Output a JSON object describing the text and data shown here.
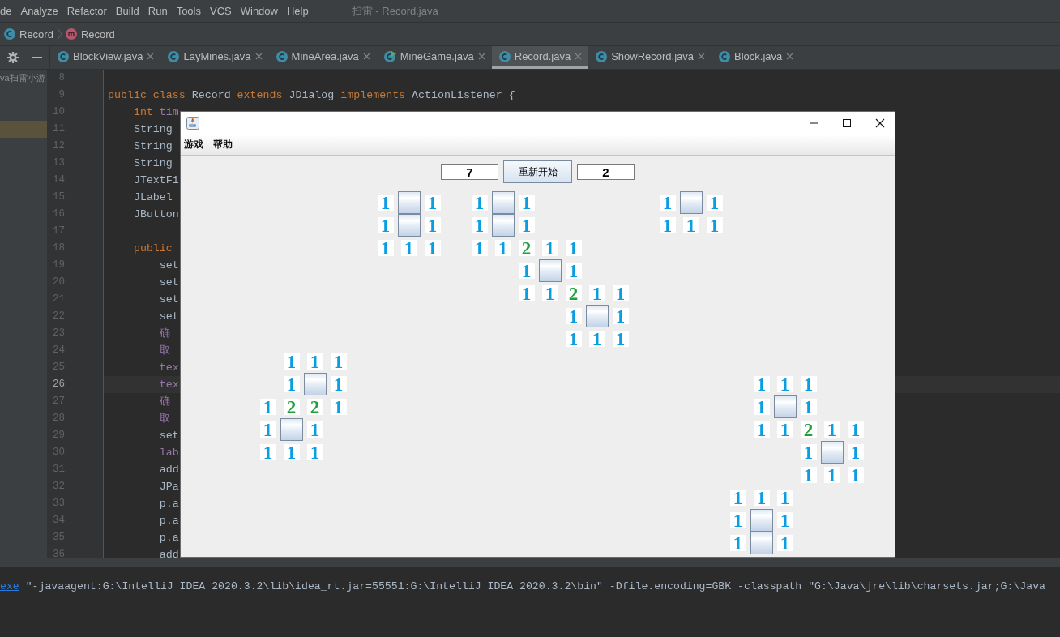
{
  "menu_bar": {
    "items": [
      "de",
      "Analyze",
      "Refactor",
      "Build",
      "Run",
      "Tools",
      "VCS",
      "Window",
      "Help"
    ],
    "title": "扫雷 - Record.java"
  },
  "breadcrumb": [
    {
      "kind": "class",
      "label": "Record"
    },
    {
      "kind": "method",
      "label": "Record"
    }
  ],
  "tabs": [
    {
      "label": "BlockView.java",
      "kind": "class",
      "selected": false
    },
    {
      "label": "LayMines.java",
      "kind": "class",
      "selected": false
    },
    {
      "label": "MineArea.java",
      "kind": "class",
      "selected": false
    },
    {
      "label": "MineGame.java",
      "kind": "runnable",
      "selected": false
    },
    {
      "label": "Record.java",
      "kind": "class",
      "selected": true
    },
    {
      "label": "ShowRecord.java",
      "kind": "class",
      "selected": false
    },
    {
      "label": "Block.java",
      "kind": "class",
      "selected": false
    }
  ],
  "project_panel": {
    "rows": [
      {
        "text": "va扫雷小游",
        "selected": false
      },
      {
        "selected": false
      },
      {
        "selected": false
      },
      {
        "selected": true
      }
    ]
  },
  "editor": {
    "lines": [
      {
        "number": "8",
        "current": false
      },
      {
        "number": "9",
        "current": false,
        "tokens": [
          {
            "kind": "keyword",
            "text": "public class"
          },
          {
            "kind": "plain",
            "text": " Record "
          },
          {
            "kind": "keyword",
            "text": "extends"
          },
          {
            "kind": "plain",
            "text": " JDialog "
          },
          {
            "kind": "keyword",
            "text": "implements"
          },
          {
            "kind": "plain",
            "text": " ActionListener {"
          }
        ]
      },
      {
        "number": "10",
        "current": false,
        "tokens": [
          {
            "kind": "keyword",
            "text": "    int"
          },
          {
            "kind": "field",
            "text": " tim"
          }
        ]
      },
      {
        "number": "11",
        "current": false,
        "tokens": [
          {
            "kind": "plain",
            "text": "    String"
          }
        ]
      },
      {
        "number": "12",
        "current": false,
        "tokens": [
          {
            "kind": "plain",
            "text": "    String"
          }
        ]
      },
      {
        "number": "13",
        "current": false,
        "tokens": [
          {
            "kind": "plain",
            "text": "    String"
          }
        ]
      },
      {
        "number": "14",
        "current": false,
        "tokens": [
          {
            "kind": "plain",
            "text": "    JTextFi"
          }
        ]
      },
      {
        "number": "15",
        "current": false,
        "tokens": [
          {
            "kind": "plain",
            "text": "    JLabel"
          }
        ]
      },
      {
        "number": "16",
        "current": false,
        "tokens": [
          {
            "kind": "plain",
            "text": "    JButton"
          }
        ]
      },
      {
        "number": "17",
        "current": false
      },
      {
        "number": "18",
        "current": false,
        "tokens": [
          {
            "kind": "keyword",
            "text": "    public"
          }
        ]
      },
      {
        "number": "19",
        "current": false,
        "tokens": [
          {
            "kind": "plain",
            "text": "        set"
          }
        ]
      },
      {
        "number": "20",
        "current": false,
        "tokens": [
          {
            "kind": "plain",
            "text": "        set"
          }
        ]
      },
      {
        "number": "21",
        "current": false,
        "tokens": [
          {
            "kind": "plain",
            "text": "        set"
          }
        ]
      },
      {
        "number": "22",
        "current": false,
        "tokens": [
          {
            "kind": "plain",
            "text": "        set"
          }
        ]
      },
      {
        "number": "23",
        "current": false,
        "tokens": [
          {
            "kind": "field",
            "text": "        确"
          }
        ]
      },
      {
        "number": "24",
        "current": false,
        "tokens": [
          {
            "kind": "field",
            "text": "        取"
          }
        ]
      },
      {
        "number": "25",
        "current": false,
        "tokens": [
          {
            "kind": "field",
            "text": "        tex"
          }
        ]
      },
      {
        "number": "26",
        "current": true,
        "tokens": [
          {
            "kind": "field",
            "text": "        tex"
          }
        ]
      },
      {
        "number": "27",
        "current": false,
        "tokens": [
          {
            "kind": "field",
            "text": "        确"
          }
        ]
      },
      {
        "number": "28",
        "current": false,
        "tokens": [
          {
            "kind": "field",
            "text": "        取"
          }
        ]
      },
      {
        "number": "29",
        "current": false,
        "tokens": [
          {
            "kind": "plain",
            "text": "        set"
          }
        ]
      },
      {
        "number": "30",
        "current": false,
        "tokens": [
          {
            "kind": "field",
            "text": "        lab"
          }
        ]
      },
      {
        "number": "31",
        "current": false,
        "tokens": [
          {
            "kind": "plain",
            "text": "        add"
          }
        ]
      },
      {
        "number": "32",
        "current": false,
        "tokens": [
          {
            "kind": "plain",
            "text": "        JPa"
          }
        ]
      },
      {
        "number": "33",
        "current": false,
        "tokens": [
          {
            "kind": "plain",
            "text": "        p.a"
          }
        ]
      },
      {
        "number": "34",
        "current": false,
        "tokens": [
          {
            "kind": "plain",
            "text": "        p.a"
          }
        ]
      },
      {
        "number": "35",
        "current": false,
        "tokens": [
          {
            "kind": "plain",
            "text": "        p.a"
          }
        ]
      },
      {
        "number": "36",
        "current": false,
        "tokens": [
          {
            "kind": "plain",
            "text": "        add"
          }
        ]
      }
    ]
  },
  "dialog": {
    "menu": [
      "游戏",
      "帮助"
    ],
    "left_counter": "7",
    "button": "重新开始",
    "right_counter": "2",
    "board": [
      {
        "cells": [
          {
            "kind": "blank"
          },
          {
            "kind": "blank"
          },
          {
            "kind": "blank"
          },
          {
            "kind": "blank"
          },
          {
            "kind": "blank"
          },
          {
            "kind": "blank"
          },
          {
            "kind": "blank"
          },
          {
            "kind": "blank"
          },
          {
            "kind": "number",
            "text": "1",
            "color": "#0a9ee0"
          },
          {
            "kind": "hidden"
          },
          {
            "kind": "number",
            "text": "1",
            "color": "#0a9ee0"
          },
          {
            "kind": "blank"
          },
          {
            "kind": "number",
            "text": "1",
            "color": "#0a9ee0"
          },
          {
            "kind": "hidden"
          },
          {
            "kind": "number",
            "text": "1",
            "color": "#0a9ee0"
          },
          {
            "kind": "blank"
          },
          {
            "kind": "blank"
          },
          {
            "kind": "blank"
          },
          {
            "kind": "blank"
          },
          {
            "kind": "blank"
          },
          {
            "kind": "number",
            "text": "1",
            "color": "#0a9ee0"
          },
          {
            "kind": "hidden"
          },
          {
            "kind": "number",
            "text": "1",
            "color": "#0a9ee0"
          },
          {
            "kind": "blank"
          },
          {
            "kind": "blank"
          },
          {
            "kind": "blank"
          },
          {
            "kind": "blank"
          },
          {
            "kind": "blank"
          },
          {
            "kind": "blank"
          },
          {
            "kind": "blank"
          }
        ]
      },
      {
        "cells": [
          {
            "kind": "blank"
          },
          {
            "kind": "blank"
          },
          {
            "kind": "blank"
          },
          {
            "kind": "blank"
          },
          {
            "kind": "blank"
          },
          {
            "kind": "blank"
          },
          {
            "kind": "blank"
          },
          {
            "kind": "blank"
          },
          {
            "kind": "number",
            "text": "1",
            "color": "#0a9ee0"
          },
          {
            "kind": "hidden"
          },
          {
            "kind": "number",
            "text": "1",
            "color": "#0a9ee0"
          },
          {
            "kind": "blank"
          },
          {
            "kind": "number",
            "text": "1",
            "color": "#0a9ee0"
          },
          {
            "kind": "hidden"
          },
          {
            "kind": "number",
            "text": "1",
            "color": "#0a9ee0"
          },
          {
            "kind": "blank"
          },
          {
            "kind": "blank"
          },
          {
            "kind": "blank"
          },
          {
            "kind": "blank"
          },
          {
            "kind": "blank"
          },
          {
            "kind": "number",
            "text": "1",
            "color": "#0a9ee0"
          },
          {
            "kind": "number",
            "text": "1",
            "color": "#0a9ee0"
          },
          {
            "kind": "number",
            "text": "1",
            "color": "#0a9ee0"
          },
          {
            "kind": "blank"
          },
          {
            "kind": "blank"
          },
          {
            "kind": "blank"
          },
          {
            "kind": "blank"
          },
          {
            "kind": "blank"
          },
          {
            "kind": "blank"
          },
          {
            "kind": "blank"
          }
        ]
      },
      {
        "cells": [
          {
            "kind": "blank"
          },
          {
            "kind": "blank"
          },
          {
            "kind": "blank"
          },
          {
            "kind": "blank"
          },
          {
            "kind": "blank"
          },
          {
            "kind": "blank"
          },
          {
            "kind": "blank"
          },
          {
            "kind": "blank"
          },
          {
            "kind": "number",
            "text": "1",
            "color": "#0a9ee0"
          },
          {
            "kind": "number",
            "text": "1",
            "color": "#0a9ee0"
          },
          {
            "kind": "number",
            "text": "1",
            "color": "#0a9ee0"
          },
          {
            "kind": "blank"
          },
          {
            "kind": "number",
            "text": "1",
            "color": "#0a9ee0"
          },
          {
            "kind": "number",
            "text": "1",
            "color": "#0a9ee0"
          },
          {
            "kind": "number",
            "text": "2",
            "color": "#1ea03c"
          },
          {
            "kind": "number",
            "text": "1",
            "color": "#0a9ee0"
          },
          {
            "kind": "number",
            "text": "1",
            "color": "#0a9ee0"
          },
          {
            "kind": "blank"
          },
          {
            "kind": "blank"
          },
          {
            "kind": "blank"
          },
          {
            "kind": "blank"
          },
          {
            "kind": "blank"
          },
          {
            "kind": "blank"
          },
          {
            "kind": "blank"
          },
          {
            "kind": "blank"
          },
          {
            "kind": "blank"
          },
          {
            "kind": "blank"
          },
          {
            "kind": "blank"
          },
          {
            "kind": "blank"
          },
          {
            "kind": "blank"
          }
        ]
      },
      {
        "cells": [
          {
            "kind": "blank"
          },
          {
            "kind": "blank"
          },
          {
            "kind": "blank"
          },
          {
            "kind": "blank"
          },
          {
            "kind": "blank"
          },
          {
            "kind": "blank"
          },
          {
            "kind": "blank"
          },
          {
            "kind": "blank"
          },
          {
            "kind": "blank"
          },
          {
            "kind": "blank"
          },
          {
            "kind": "blank"
          },
          {
            "kind": "blank"
          },
          {
            "kind": "blank"
          },
          {
            "kind": "blank"
          },
          {
            "kind": "number",
            "text": "1",
            "color": "#0a9ee0"
          },
          {
            "kind": "hidden"
          },
          {
            "kind": "number",
            "text": "1",
            "color": "#0a9ee0"
          },
          {
            "kind": "blank"
          },
          {
            "kind": "blank"
          },
          {
            "kind": "blank"
          },
          {
            "kind": "blank"
          },
          {
            "kind": "blank"
          },
          {
            "kind": "blank"
          },
          {
            "kind": "blank"
          },
          {
            "kind": "blank"
          },
          {
            "kind": "blank"
          },
          {
            "kind": "blank"
          },
          {
            "kind": "blank"
          },
          {
            "kind": "blank"
          },
          {
            "kind": "blank"
          }
        ]
      },
      {
        "cells": [
          {
            "kind": "blank"
          },
          {
            "kind": "blank"
          },
          {
            "kind": "blank"
          },
          {
            "kind": "blank"
          },
          {
            "kind": "blank"
          },
          {
            "kind": "blank"
          },
          {
            "kind": "blank"
          },
          {
            "kind": "blank"
          },
          {
            "kind": "blank"
          },
          {
            "kind": "blank"
          },
          {
            "kind": "blank"
          },
          {
            "kind": "blank"
          },
          {
            "kind": "blank"
          },
          {
            "kind": "blank"
          },
          {
            "kind": "number",
            "text": "1",
            "color": "#0a9ee0"
          },
          {
            "kind": "number",
            "text": "1",
            "color": "#0a9ee0"
          },
          {
            "kind": "number",
            "text": "2",
            "color": "#1ea03c"
          },
          {
            "kind": "number",
            "text": "1",
            "color": "#0a9ee0"
          },
          {
            "kind": "number",
            "text": "1",
            "color": "#0a9ee0"
          },
          {
            "kind": "blank"
          },
          {
            "kind": "blank"
          },
          {
            "kind": "blank"
          },
          {
            "kind": "blank"
          },
          {
            "kind": "blank"
          },
          {
            "kind": "blank"
          },
          {
            "kind": "blank"
          },
          {
            "kind": "blank"
          },
          {
            "kind": "blank"
          },
          {
            "kind": "blank"
          },
          {
            "kind": "blank"
          }
        ]
      },
      {
        "cells": [
          {
            "kind": "blank"
          },
          {
            "kind": "blank"
          },
          {
            "kind": "blank"
          },
          {
            "kind": "blank"
          },
          {
            "kind": "blank"
          },
          {
            "kind": "blank"
          },
          {
            "kind": "blank"
          },
          {
            "kind": "blank"
          },
          {
            "kind": "blank"
          },
          {
            "kind": "blank"
          },
          {
            "kind": "blank"
          },
          {
            "kind": "blank"
          },
          {
            "kind": "blank"
          },
          {
            "kind": "blank"
          },
          {
            "kind": "blank"
          },
          {
            "kind": "blank"
          },
          {
            "kind": "number",
            "text": "1",
            "color": "#0a9ee0"
          },
          {
            "kind": "hidden"
          },
          {
            "kind": "number",
            "text": "1",
            "color": "#0a9ee0"
          },
          {
            "kind": "blank"
          },
          {
            "kind": "blank"
          },
          {
            "kind": "blank"
          },
          {
            "kind": "blank"
          },
          {
            "kind": "blank"
          },
          {
            "kind": "blank"
          },
          {
            "kind": "blank"
          },
          {
            "kind": "blank"
          },
          {
            "kind": "blank"
          },
          {
            "kind": "blank"
          },
          {
            "kind": "blank"
          }
        ]
      },
      {
        "cells": [
          {
            "kind": "blank"
          },
          {
            "kind": "blank"
          },
          {
            "kind": "blank"
          },
          {
            "kind": "blank"
          },
          {
            "kind": "blank"
          },
          {
            "kind": "blank"
          },
          {
            "kind": "blank"
          },
          {
            "kind": "blank"
          },
          {
            "kind": "blank"
          },
          {
            "kind": "blank"
          },
          {
            "kind": "blank"
          },
          {
            "kind": "blank"
          },
          {
            "kind": "blank"
          },
          {
            "kind": "blank"
          },
          {
            "kind": "blank"
          },
          {
            "kind": "blank"
          },
          {
            "kind": "number",
            "text": "1",
            "color": "#0a9ee0"
          },
          {
            "kind": "number",
            "text": "1",
            "color": "#0a9ee0"
          },
          {
            "kind": "number",
            "text": "1",
            "color": "#0a9ee0"
          },
          {
            "kind": "blank"
          },
          {
            "kind": "blank"
          },
          {
            "kind": "blank"
          },
          {
            "kind": "blank"
          },
          {
            "kind": "blank"
          },
          {
            "kind": "blank"
          },
          {
            "kind": "blank"
          },
          {
            "kind": "blank"
          },
          {
            "kind": "blank"
          },
          {
            "kind": "blank"
          },
          {
            "kind": "blank"
          }
        ]
      },
      {
        "cells": [
          {
            "kind": "blank"
          },
          {
            "kind": "blank"
          },
          {
            "kind": "blank"
          },
          {
            "kind": "blank"
          },
          {
            "kind": "number",
            "text": "1",
            "color": "#0a9ee0"
          },
          {
            "kind": "number",
            "text": "1",
            "color": "#0a9ee0"
          },
          {
            "kind": "number",
            "text": "1",
            "color": "#0a9ee0"
          },
          {
            "kind": "blank"
          },
          {
            "kind": "blank"
          },
          {
            "kind": "blank"
          },
          {
            "kind": "blank"
          },
          {
            "kind": "blank"
          },
          {
            "kind": "blank"
          },
          {
            "kind": "blank"
          },
          {
            "kind": "blank"
          },
          {
            "kind": "blank"
          },
          {
            "kind": "blank"
          },
          {
            "kind": "blank"
          },
          {
            "kind": "blank"
          },
          {
            "kind": "blank"
          },
          {
            "kind": "blank"
          },
          {
            "kind": "blank"
          },
          {
            "kind": "blank"
          },
          {
            "kind": "blank"
          },
          {
            "kind": "blank"
          },
          {
            "kind": "blank"
          },
          {
            "kind": "blank"
          },
          {
            "kind": "blank"
          },
          {
            "kind": "blank"
          },
          {
            "kind": "blank"
          }
        ]
      },
      {
        "cells": [
          {
            "kind": "blank"
          },
          {
            "kind": "blank"
          },
          {
            "kind": "blank"
          },
          {
            "kind": "blank"
          },
          {
            "kind": "number",
            "text": "1",
            "color": "#0a9ee0"
          },
          {
            "kind": "hidden"
          },
          {
            "kind": "number",
            "text": "1",
            "color": "#0a9ee0"
          },
          {
            "kind": "blank"
          },
          {
            "kind": "blank"
          },
          {
            "kind": "blank"
          },
          {
            "kind": "blank"
          },
          {
            "kind": "blank"
          },
          {
            "kind": "blank"
          },
          {
            "kind": "blank"
          },
          {
            "kind": "blank"
          },
          {
            "kind": "blank"
          },
          {
            "kind": "blank"
          },
          {
            "kind": "blank"
          },
          {
            "kind": "blank"
          },
          {
            "kind": "blank"
          },
          {
            "kind": "blank"
          },
          {
            "kind": "blank"
          },
          {
            "kind": "blank"
          },
          {
            "kind": "blank"
          },
          {
            "kind": "number",
            "text": "1",
            "color": "#0a9ee0"
          },
          {
            "kind": "number",
            "text": "1",
            "color": "#0a9ee0"
          },
          {
            "kind": "number",
            "text": "1",
            "color": "#0a9ee0"
          },
          {
            "kind": "blank"
          },
          {
            "kind": "blank"
          },
          {
            "kind": "blank"
          }
        ]
      },
      {
        "cells": [
          {
            "kind": "blank"
          },
          {
            "kind": "blank"
          },
          {
            "kind": "blank"
          },
          {
            "kind": "number",
            "text": "1",
            "color": "#0a9ee0"
          },
          {
            "kind": "number",
            "text": "2",
            "color": "#1ea03c"
          },
          {
            "kind": "number",
            "text": "2",
            "color": "#1ea03c"
          },
          {
            "kind": "number",
            "text": "1",
            "color": "#0a9ee0"
          },
          {
            "kind": "blank"
          },
          {
            "kind": "blank"
          },
          {
            "kind": "blank"
          },
          {
            "kind": "blank"
          },
          {
            "kind": "blank"
          },
          {
            "kind": "blank"
          },
          {
            "kind": "blank"
          },
          {
            "kind": "blank"
          },
          {
            "kind": "blank"
          },
          {
            "kind": "blank"
          },
          {
            "kind": "blank"
          },
          {
            "kind": "blank"
          },
          {
            "kind": "blank"
          },
          {
            "kind": "blank"
          },
          {
            "kind": "blank"
          },
          {
            "kind": "blank"
          },
          {
            "kind": "blank"
          },
          {
            "kind": "number",
            "text": "1",
            "color": "#0a9ee0"
          },
          {
            "kind": "hidden"
          },
          {
            "kind": "number",
            "text": "1",
            "color": "#0a9ee0"
          },
          {
            "kind": "blank"
          },
          {
            "kind": "blank"
          },
          {
            "kind": "blank"
          }
        ]
      },
      {
        "cells": [
          {
            "kind": "blank"
          },
          {
            "kind": "blank"
          },
          {
            "kind": "blank"
          },
          {
            "kind": "number",
            "text": "1",
            "color": "#0a9ee0"
          },
          {
            "kind": "hidden"
          },
          {
            "kind": "number",
            "text": "1",
            "color": "#0a9ee0"
          },
          {
            "kind": "blank"
          },
          {
            "kind": "blank"
          },
          {
            "kind": "blank"
          },
          {
            "kind": "blank"
          },
          {
            "kind": "blank"
          },
          {
            "kind": "blank"
          },
          {
            "kind": "blank"
          },
          {
            "kind": "blank"
          },
          {
            "kind": "blank"
          },
          {
            "kind": "blank"
          },
          {
            "kind": "blank"
          },
          {
            "kind": "blank"
          },
          {
            "kind": "blank"
          },
          {
            "kind": "blank"
          },
          {
            "kind": "blank"
          },
          {
            "kind": "blank"
          },
          {
            "kind": "blank"
          },
          {
            "kind": "blank"
          },
          {
            "kind": "number",
            "text": "1",
            "color": "#0a9ee0"
          },
          {
            "kind": "number",
            "text": "1",
            "color": "#0a9ee0"
          },
          {
            "kind": "number",
            "text": "2",
            "color": "#1ea03c"
          },
          {
            "kind": "number",
            "text": "1",
            "color": "#0a9ee0"
          },
          {
            "kind": "number",
            "text": "1",
            "color": "#0a9ee0"
          },
          {
            "kind": "blank"
          }
        ]
      },
      {
        "cells": [
          {
            "kind": "blank"
          },
          {
            "kind": "blank"
          },
          {
            "kind": "blank"
          },
          {
            "kind": "number",
            "text": "1",
            "color": "#0a9ee0"
          },
          {
            "kind": "number",
            "text": "1",
            "color": "#0a9ee0"
          },
          {
            "kind": "number",
            "text": "1",
            "color": "#0a9ee0"
          },
          {
            "kind": "blank"
          },
          {
            "kind": "blank"
          },
          {
            "kind": "blank"
          },
          {
            "kind": "blank"
          },
          {
            "kind": "blank"
          },
          {
            "kind": "blank"
          },
          {
            "kind": "blank"
          },
          {
            "kind": "blank"
          },
          {
            "kind": "blank"
          },
          {
            "kind": "blank"
          },
          {
            "kind": "blank"
          },
          {
            "kind": "blank"
          },
          {
            "kind": "blank"
          },
          {
            "kind": "blank"
          },
          {
            "kind": "blank"
          },
          {
            "kind": "blank"
          },
          {
            "kind": "blank"
          },
          {
            "kind": "blank"
          },
          {
            "kind": "blank"
          },
          {
            "kind": "blank"
          },
          {
            "kind": "number",
            "text": "1",
            "color": "#0a9ee0"
          },
          {
            "kind": "hidden"
          },
          {
            "kind": "number",
            "text": "1",
            "color": "#0a9ee0"
          },
          {
            "kind": "blank"
          }
        ]
      },
      {
        "cells": [
          {
            "kind": "blank"
          },
          {
            "kind": "blank"
          },
          {
            "kind": "blank"
          },
          {
            "kind": "blank"
          },
          {
            "kind": "blank"
          },
          {
            "kind": "blank"
          },
          {
            "kind": "blank"
          },
          {
            "kind": "blank"
          },
          {
            "kind": "blank"
          },
          {
            "kind": "blank"
          },
          {
            "kind": "blank"
          },
          {
            "kind": "blank"
          },
          {
            "kind": "blank"
          },
          {
            "kind": "blank"
          },
          {
            "kind": "blank"
          },
          {
            "kind": "blank"
          },
          {
            "kind": "blank"
          },
          {
            "kind": "blank"
          },
          {
            "kind": "blank"
          },
          {
            "kind": "blank"
          },
          {
            "kind": "blank"
          },
          {
            "kind": "blank"
          },
          {
            "kind": "blank"
          },
          {
            "kind": "blank"
          },
          {
            "kind": "blank"
          },
          {
            "kind": "blank"
          },
          {
            "kind": "number",
            "text": "1",
            "color": "#0a9ee0"
          },
          {
            "kind": "number",
            "text": "1",
            "color": "#0a9ee0"
          },
          {
            "kind": "number",
            "text": "1",
            "color": "#0a9ee0"
          },
          {
            "kind": "blank"
          }
        ]
      },
      {
        "cells": [
          {
            "kind": "blank"
          },
          {
            "kind": "blank"
          },
          {
            "kind": "blank"
          },
          {
            "kind": "blank"
          },
          {
            "kind": "blank"
          },
          {
            "kind": "blank"
          },
          {
            "kind": "blank"
          },
          {
            "kind": "blank"
          },
          {
            "kind": "blank"
          },
          {
            "kind": "blank"
          },
          {
            "kind": "blank"
          },
          {
            "kind": "blank"
          },
          {
            "kind": "blank"
          },
          {
            "kind": "blank"
          },
          {
            "kind": "blank"
          },
          {
            "kind": "blank"
          },
          {
            "kind": "blank"
          },
          {
            "kind": "blank"
          },
          {
            "kind": "blank"
          },
          {
            "kind": "blank"
          },
          {
            "kind": "blank"
          },
          {
            "kind": "blank"
          },
          {
            "kind": "blank"
          },
          {
            "kind": "number",
            "text": "1",
            "color": "#0a9ee0"
          },
          {
            "kind": "number",
            "text": "1",
            "color": "#0a9ee0"
          },
          {
            "kind": "number",
            "text": "1",
            "color": "#0a9ee0"
          },
          {
            "kind": "blank"
          },
          {
            "kind": "blank"
          },
          {
            "kind": "blank"
          },
          {
            "kind": "blank"
          }
        ]
      },
      {
        "cells": [
          {
            "kind": "blank"
          },
          {
            "kind": "blank"
          },
          {
            "kind": "blank"
          },
          {
            "kind": "blank"
          },
          {
            "kind": "blank"
          },
          {
            "kind": "blank"
          },
          {
            "kind": "blank"
          },
          {
            "kind": "blank"
          },
          {
            "kind": "blank"
          },
          {
            "kind": "blank"
          },
          {
            "kind": "blank"
          },
          {
            "kind": "blank"
          },
          {
            "kind": "blank"
          },
          {
            "kind": "blank"
          },
          {
            "kind": "blank"
          },
          {
            "kind": "blank"
          },
          {
            "kind": "blank"
          },
          {
            "kind": "blank"
          },
          {
            "kind": "blank"
          },
          {
            "kind": "blank"
          },
          {
            "kind": "blank"
          },
          {
            "kind": "blank"
          },
          {
            "kind": "blank"
          },
          {
            "kind": "number",
            "text": "1",
            "color": "#0a9ee0"
          },
          {
            "kind": "hidden"
          },
          {
            "kind": "number",
            "text": "1",
            "color": "#0a9ee0"
          },
          {
            "kind": "blank"
          },
          {
            "kind": "blank"
          },
          {
            "kind": "blank"
          },
          {
            "kind": "blank"
          }
        ]
      },
      {
        "cells": [
          {
            "kind": "blank"
          },
          {
            "kind": "blank"
          },
          {
            "kind": "blank"
          },
          {
            "kind": "blank"
          },
          {
            "kind": "blank"
          },
          {
            "kind": "blank"
          },
          {
            "kind": "blank"
          },
          {
            "kind": "blank"
          },
          {
            "kind": "blank"
          },
          {
            "kind": "blank"
          },
          {
            "kind": "blank"
          },
          {
            "kind": "blank"
          },
          {
            "kind": "blank"
          },
          {
            "kind": "blank"
          },
          {
            "kind": "blank"
          },
          {
            "kind": "blank"
          },
          {
            "kind": "blank"
          },
          {
            "kind": "blank"
          },
          {
            "kind": "blank"
          },
          {
            "kind": "blank"
          },
          {
            "kind": "blank"
          },
          {
            "kind": "blank"
          },
          {
            "kind": "blank"
          },
          {
            "kind": "number",
            "text": "1",
            "color": "#0a9ee0"
          },
          {
            "kind": "hidden"
          },
          {
            "kind": "number",
            "text": "1",
            "color": "#0a9ee0"
          },
          {
            "kind": "blank"
          },
          {
            "kind": "blank"
          },
          {
            "kind": "blank"
          },
          {
            "kind": "blank"
          }
        ]
      }
    ]
  },
  "console": {
    "link": "exe",
    "text": "\"-javaagent:G:\\IntelliJ IDEA 2020.3.2\\lib\\idea_rt.jar=55551:G:\\IntelliJ IDEA 2020.3.2\\bin\" -Dfile.encoding=GBK -classpath \"G:\\Java\\jre\\lib\\charsets.jar;G:\\Java"
  }
}
